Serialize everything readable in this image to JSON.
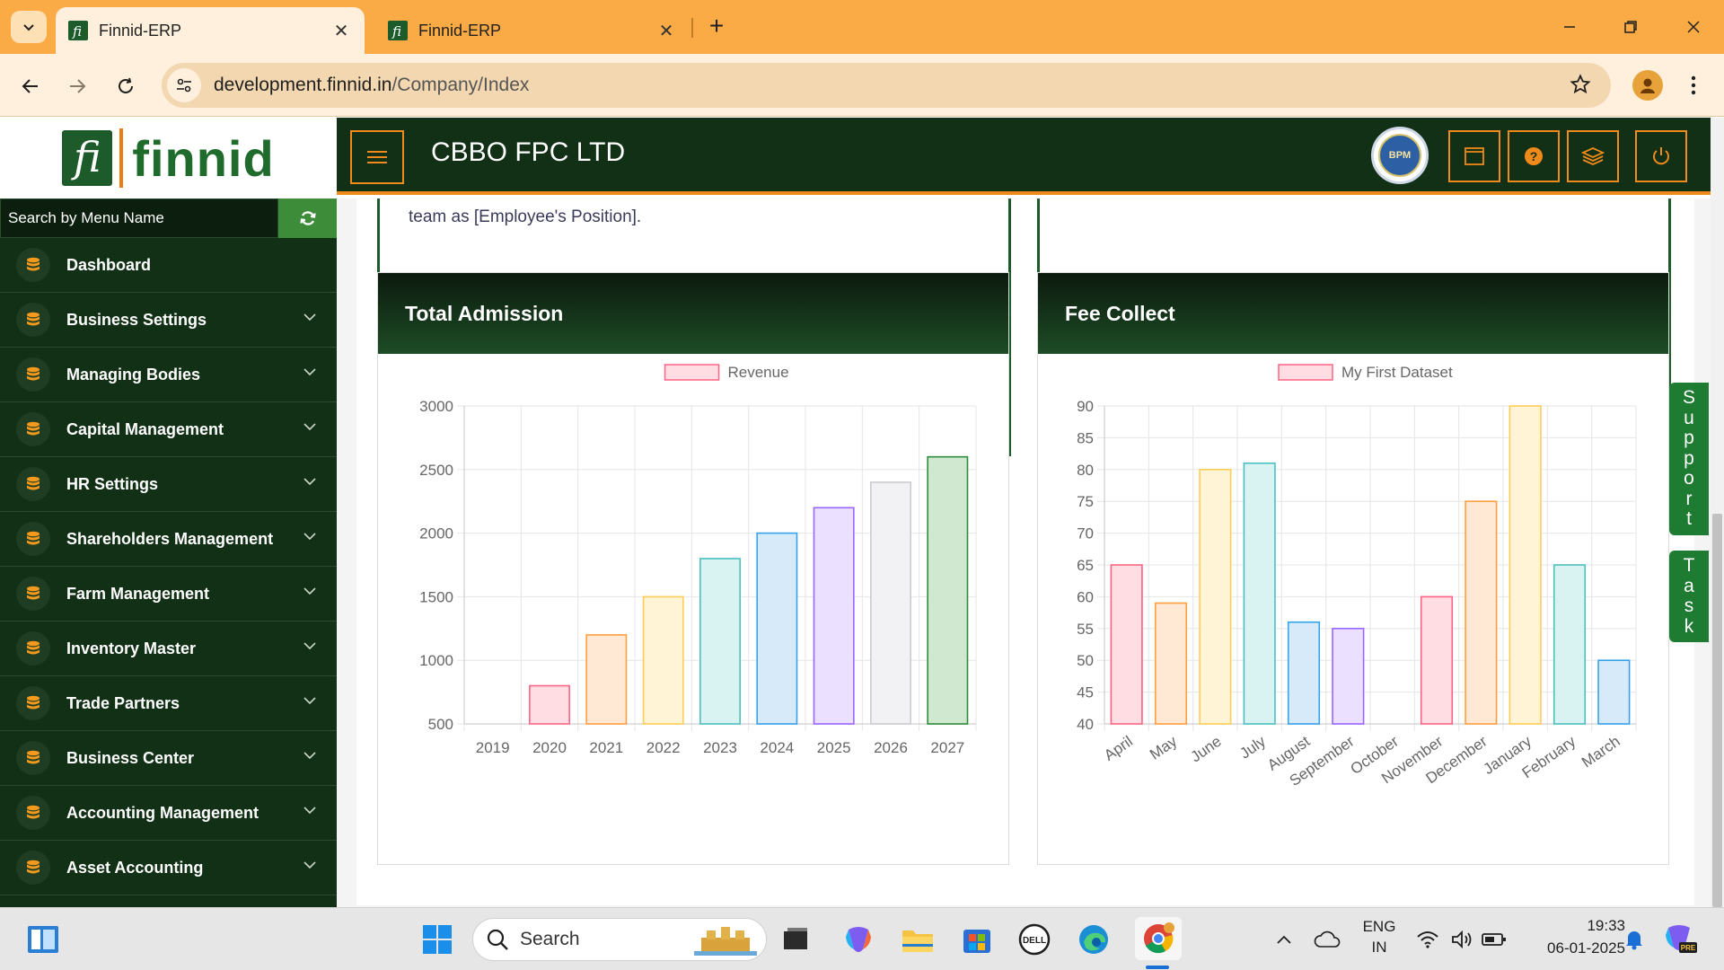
{
  "browser": {
    "tabs": [
      {
        "title": "Finnid-ERP",
        "active": true
      },
      {
        "title": "Finnid-ERP",
        "active": false
      }
    ],
    "url_host": "development.finnid.in",
    "url_path": "/Company/Index"
  },
  "app": {
    "logo_text": "finnid",
    "logo_letter": "fi",
    "company_name": "CBBO FPC LTD",
    "badge_text": "BPM"
  },
  "sidebar": {
    "search_placeholder": "Search by Menu Name",
    "items": [
      {
        "label": "Dashboard",
        "has_children": false
      },
      {
        "label": "Business Settings",
        "has_children": true
      },
      {
        "label": "Managing Bodies",
        "has_children": true
      },
      {
        "label": "Capital Management",
        "has_children": true
      },
      {
        "label": "HR Settings",
        "has_children": true
      },
      {
        "label": "Shareholders Management",
        "has_children": true
      },
      {
        "label": "Farm Management",
        "has_children": true
      },
      {
        "label": "Inventory Master",
        "has_children": true
      },
      {
        "label": "Trade Partners",
        "has_children": true
      },
      {
        "label": "Business Center",
        "has_children": true
      },
      {
        "label": "Accounting Management",
        "has_children": true
      },
      {
        "label": "Asset Accounting",
        "has_children": true
      }
    ]
  },
  "main": {
    "top_card_text": "team as [Employee's Position]."
  },
  "chart_data": [
    {
      "title": "Total Admission",
      "type": "bar",
      "legend": "Revenue",
      "categories": [
        "2019",
        "2020",
        "2021",
        "2022",
        "2023",
        "2024",
        "2025",
        "2026",
        "2027"
      ],
      "values": [
        null,
        800,
        1200,
        1500,
        1800,
        2000,
        2200,
        2400,
        2600
      ],
      "ylim": [
        500,
        3000
      ],
      "yticks": [
        500,
        1000,
        1500,
        2000,
        2500,
        3000
      ],
      "grid": true
    },
    {
      "title": "Fee Collect",
      "type": "bar",
      "legend": "My First Dataset",
      "categories": [
        "April",
        "May",
        "June",
        "July",
        "August",
        "September",
        "October",
        "November",
        "December",
        "January",
        "February",
        "March"
      ],
      "values": [
        65,
        59,
        80,
        81,
        56,
        55,
        40,
        60,
        75,
        90,
        65,
        50
      ],
      "ylim": [
        40,
        90
      ],
      "yticks": [
        40,
        45,
        50,
        55,
        60,
        65,
        70,
        75,
        80,
        85,
        90
      ],
      "grid": true
    }
  ],
  "side_tabs": {
    "support": "Support",
    "task": "Task"
  },
  "taskbar": {
    "search_label": "Search",
    "lang_line1": "ENG",
    "lang_line2": "IN",
    "time": "19:33",
    "date": "06-01-2025"
  },
  "colors": {
    "tabbar": "#fbab45",
    "header": "#123016",
    "accent": "#f08a1a",
    "brand_green": "#1e6b2c",
    "bar_fills": [
      "#ffdde3",
      "#ffe8d4",
      "#fff4d6",
      "#d9f2f2",
      "#d6eafa",
      "#ebe0ff",
      "#f2f2f4",
      "#cfe8cf"
    ],
    "bar_strokes": [
      "#ff6384",
      "#ff9f40",
      "#ffcd56",
      "#4bc0c0",
      "#36a2eb",
      "#9966ff",
      "#c9cbcf",
      "#2e8b3a"
    ]
  }
}
